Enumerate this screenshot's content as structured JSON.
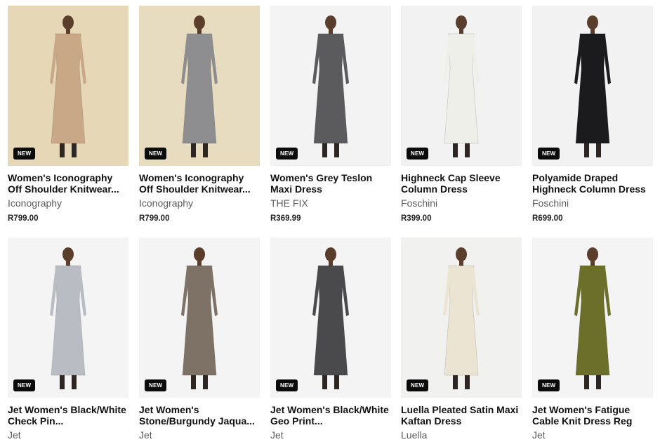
{
  "products": [
    {
      "name": "Women's Iconography Off Shoulder Knitwear...",
      "brand": "Iconography",
      "price": "R799.00",
      "badge": "NEW",
      "bg": "#e6d8b6",
      "garment": "#c9a887"
    },
    {
      "name": "Women's Iconography Off Shoulder Knitwear...",
      "brand": "Iconography",
      "price": "R799.00",
      "badge": "NEW",
      "bg": "#e8dcc0",
      "garment": "#8e8e90"
    },
    {
      "name": "Women's Grey Teslon Maxi Dress",
      "brand": "THE FIX",
      "price": "R369.99",
      "badge": "NEW",
      "bg": "#f3f3f3",
      "garment": "#5b5b5e"
    },
    {
      "name": "Highneck Cap Sleeve Column Dress",
      "brand": "Foschini",
      "price": "R399.00",
      "badge": "NEW",
      "bg": "#f2f2f2",
      "garment": "#efefea"
    },
    {
      "name": "Polyamide Draped Highneck Column Dress",
      "brand": "Foschini",
      "price": "R699.00",
      "badge": "NEW",
      "bg": "#f2f2f2",
      "garment": "#1b1b1d"
    },
    {
      "name": "Jet Women's Black/White Check Pin...",
      "brand": "Jet",
      "price": "",
      "badge": "NEW",
      "bg": "#f4f4f4",
      "garment": "#b9bcc2"
    },
    {
      "name": "Jet Women's Stone/Burgundy Jaqua...",
      "brand": "Jet",
      "price": "",
      "badge": "NEW",
      "bg": "#f4f4f4",
      "garment": "#7e7266"
    },
    {
      "name": "Jet Women's Black/White Geo Print...",
      "brand": "Jet",
      "price": "",
      "badge": "NEW",
      "bg": "#f4f4f4",
      "garment": "#4a4a4c"
    },
    {
      "name": "Luella Pleated Satin Maxi Kaftan Dress",
      "brand": "Luella",
      "price": "",
      "badge": "NEW",
      "bg": "#f1f1f0",
      "garment": "#ece4d3"
    },
    {
      "name": "Jet Women's Fatigue Cable Knit Dress Reg",
      "brand": "Jet",
      "price": "",
      "badge": "NEW",
      "bg": "#f4f4f4",
      "garment": "#6b6f2a"
    }
  ]
}
